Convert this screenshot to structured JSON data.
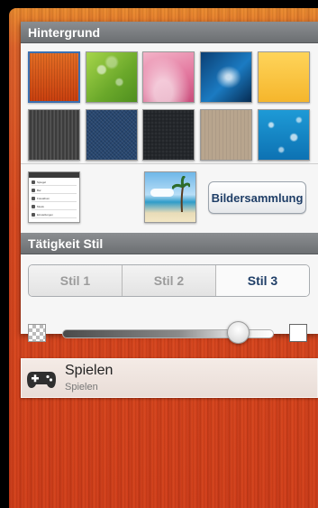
{
  "background_section": {
    "title": "Hintergrund",
    "collection_button": "Bildersammlung",
    "thumbnails": [
      {
        "name": "wood-orange",
        "selected": true
      },
      {
        "name": "green-bokeh",
        "selected": false
      },
      {
        "name": "pink-abstract",
        "selected": false
      },
      {
        "name": "blue-swirl",
        "selected": false
      },
      {
        "name": "yellow",
        "selected": false
      },
      {
        "name": "dark-stripes",
        "selected": false
      },
      {
        "name": "denim",
        "selected": false
      },
      {
        "name": "black-leather",
        "selected": false
      },
      {
        "name": "beige-wood",
        "selected": false
      },
      {
        "name": "water-drops",
        "selected": false
      }
    ],
    "screenshot_thumb_rows": [
      "Spiegel",
      "Bar",
      "Fotoalbum",
      "Musik",
      "Einstellungen"
    ]
  },
  "activity_section": {
    "title": "Tätigkeit Stil",
    "styles": [
      {
        "label": "Stil 1",
        "active": false
      },
      {
        "label": "Stil 2",
        "active": false
      },
      {
        "label": "Stil 3",
        "active": true
      }
    ],
    "opacity_slider_value": 0.83
  },
  "activity_item": {
    "title": "Spielen",
    "subtitle": "Spielen",
    "icon": "gamepad-icon"
  },
  "colors": {
    "accent": "#1f3e67",
    "header": "#7a7d80",
    "wood_background": "#d9471f"
  }
}
